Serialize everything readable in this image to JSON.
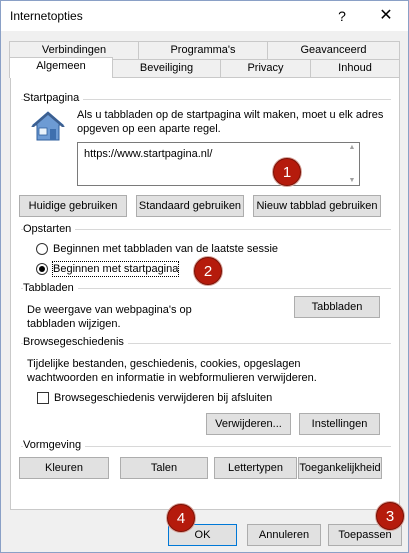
{
  "window": {
    "title": "Internetopties",
    "help_label": "?",
    "close_label": "✕"
  },
  "tabs": {
    "row1": [
      "Verbindingen",
      "Programma's",
      "Geavanceerd"
    ],
    "row2": [
      "Algemeen",
      "Beveiliging",
      "Privacy",
      "Inhoud"
    ],
    "active": "Algemeen"
  },
  "startpagina": {
    "label": "Startpagina",
    "description": "Als u tabbladen op de startpagina wilt maken, moet u elk adres opgeven op een aparte regel.",
    "url": "https://www.startpagina.nl/",
    "buttons": [
      "Huidige gebruiken",
      "Standaard gebruiken",
      "Nieuw tabblad gebruiken"
    ]
  },
  "opstarten": {
    "label": "Opstarten",
    "options": [
      "Beginnen met tabbladen van de laatste sessie",
      "Beginnen met startpagina"
    ],
    "selected": 1
  },
  "tabbladen": {
    "label": "Tabbladen",
    "description": "De weergave van webpagina's op tabbladen wijzigen.",
    "button": "Tabbladen"
  },
  "browsegeschiedenis": {
    "label": "Browsegeschiedenis",
    "description": "Tijdelijke bestanden, geschiedenis, cookies, opgeslagen wachtwoorden en informatie in webformulieren verwijderen.",
    "checkbox_label": "Browsegeschiedenis verwijderen bij afsluiten",
    "checked": false,
    "delete_button": "Verwijderen...",
    "settings_button": "Instellingen"
  },
  "vormgeving": {
    "label": "Vormgeving",
    "buttons": [
      "Kleuren",
      "Talen",
      "Lettertypen",
      "Toegankelijkheid"
    ]
  },
  "footer": {
    "ok": "OK",
    "cancel": "Annuleren",
    "apply": "Toepassen"
  },
  "annotations": [
    "1",
    "2",
    "3",
    "4"
  ]
}
